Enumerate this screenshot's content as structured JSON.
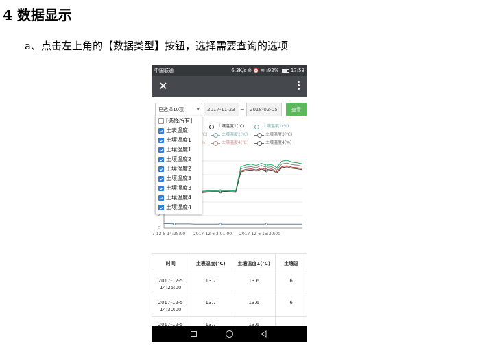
{
  "doc": {
    "heading": "4 数据显示",
    "step": "a、点击左上角的【数据类型】按钮，选择需要查询的选项"
  },
  "status_bar": {
    "carrier": "中国联通",
    "right": "6.3K/s ⊗ ⏰ ≋ ᵢₗ92%",
    "time": "17:53"
  },
  "app_bar": {
    "close_icon": "close-icon",
    "more_icon": "more-vertical-icon"
  },
  "filter": {
    "type_select": "已选择10项",
    "date_start": "2017-11-23",
    "separator": "~",
    "date_end": "2018-02-05",
    "query_button": "查看"
  },
  "legend": [
    {
      "name": "土壤温度1(℃)",
      "color": "#333333"
    },
    {
      "name": "土壤温度1(%)",
      "color": "#6fa8a8"
    },
    {
      "name": "(℃)",
      "color": "#c89b9b"
    },
    {
      "name": "土壤温度2(%)",
      "color": "#7fb5b5"
    },
    {
      "name": "土壤温度3(℃)",
      "color": "#7a7a7a"
    },
    {
      "name": "(%)",
      "color": "#d9a0a0"
    },
    {
      "name": "土壤温度4(℃)",
      "color": "#d08f8f"
    },
    {
      "name": "土壤温度4(%)",
      "color": "#6b6b6b"
    }
  ],
  "dropdown": {
    "items": [
      {
        "label": "[选择所有]",
        "checked": false
      },
      {
        "label": "土表温度",
        "checked": true
      },
      {
        "label": "土壤温度1",
        "checked": true
      },
      {
        "label": "土壤湿度1",
        "checked": true
      },
      {
        "label": "土壤温度2",
        "checked": true
      },
      {
        "label": "土壤湿度2",
        "checked": true
      },
      {
        "label": "土壤温度3",
        "checked": true
      },
      {
        "label": "土壤湿度3",
        "checked": true
      },
      {
        "label": "土壤温度4",
        "checked": true
      },
      {
        "label": "土壤湿度4",
        "checked": true
      }
    ]
  },
  "chart_data": {
    "type": "line",
    "x_ticks": [
      "7-12-5 14:25:00",
      "2017-12-6 3:01:00",
      "2017-12-6 15:30:00"
    ],
    "y_ticks": [
      "0",
      "5"
    ],
    "series": [
      {
        "color": "#c0392b",
        "values": [
          13.7,
          13.4,
          13.2,
          13.0,
          12.9,
          12.8,
          12.8,
          12.7,
          12.9,
          13.0,
          13.1,
          13.0,
          13.2,
          13.0,
          12.9,
          20.5,
          21.0,
          21.2,
          20.8,
          21.5,
          20.9,
          21.2,
          20.2,
          22.0,
          22.3,
          21.8,
          21.6,
          21.3
        ]
      },
      {
        "color": "#7f8c8d",
        "values": [
          13.9,
          13.6,
          13.4,
          13.2,
          13.1,
          13.0,
          13.0,
          12.9,
          13.1,
          13.2,
          13.3,
          13.2,
          13.4,
          13.2,
          13.1,
          21.2,
          21.8,
          22.0,
          21.6,
          22.4,
          21.7,
          22.0,
          20.8,
          23.0,
          23.3,
          22.7,
          22.5,
          22.1
        ]
      },
      {
        "color": "#27ae60",
        "values": [
          14.1,
          13.8,
          13.6,
          13.4,
          13.3,
          13.2,
          13.2,
          13.1,
          13.3,
          13.4,
          13.5,
          13.4,
          13.6,
          13.4,
          13.3,
          22.0,
          22.6,
          22.9,
          22.4,
          23.2,
          22.5,
          22.8,
          21.6,
          24.0,
          24.3,
          23.6,
          23.4,
          23.0
        ]
      },
      {
        "color": "#444444",
        "values": [
          13.5,
          13.3,
          13.1,
          12.9,
          12.8,
          12.7,
          12.7,
          12.6,
          12.8,
          12.9,
          13.0,
          12.9,
          13.1,
          12.9,
          12.8,
          20.1,
          20.6,
          20.8,
          20.4,
          21.1,
          20.5,
          20.8,
          19.8,
          21.6,
          21.9,
          21.4,
          21.2,
          20.9
        ]
      },
      {
        "color": "#5d7f99",
        "values": [
          1.6,
          1.6,
          1.5,
          1.5,
          1.5,
          1.5,
          1.4,
          1.4,
          1.4,
          1.4,
          1.4,
          1.4,
          1.4,
          1.4,
          1.4,
          1.4,
          1.4,
          1.4,
          1.4,
          1.4,
          1.4,
          1.4,
          1.4,
          1.4,
          1.4,
          1.4,
          1.4,
          1.4
        ]
      }
    ],
    "ylim": [
      0,
      27
    ]
  },
  "table": {
    "headers": [
      "时间",
      "土表温度(℃)",
      "土壤温度1(℃)",
      "土壤温"
    ],
    "rows": [
      {
        "time": "2017-12-5 14:25:00",
        "c1": "13.7",
        "c2": "13.6",
        "c3": "6"
      },
      {
        "time": "2017-12-5 14:30:00",
        "c1": "13.7",
        "c2": "13.6",
        "c3": "6"
      },
      {
        "time": "2017-12-5",
        "c1": "13.7",
        "c2": "13.6",
        "c3": ""
      }
    ]
  }
}
